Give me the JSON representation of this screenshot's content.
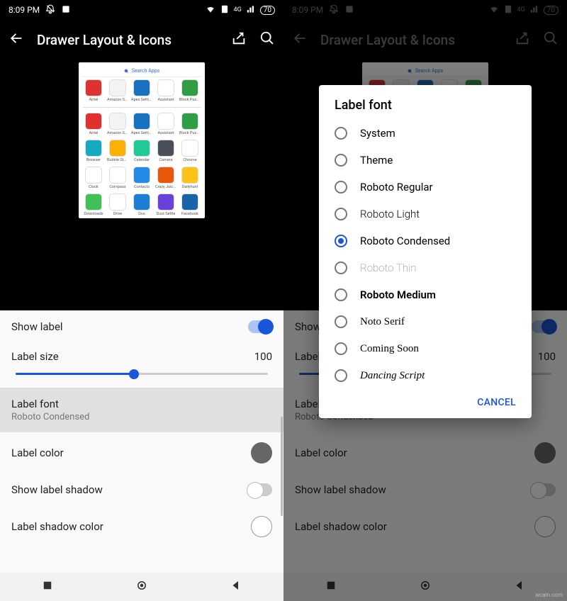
{
  "status": {
    "time": "8:09 PM",
    "battery": "70"
  },
  "appbar": {
    "title": "Drawer Layout & Icons"
  },
  "preview": {
    "search_placeholder": "Search Apps",
    "row1": [
      "Airtel",
      "Amazon Sh..",
      "Apex Settin..",
      "Assistant",
      "Block Puzzl.."
    ],
    "row2": [
      "Airtel",
      "Amazon Sh..",
      "Apex Settin..",
      "Assistant",
      "Block Puzzl.."
    ],
    "row3": [
      "Browser",
      "Bubble Story",
      "Calendar",
      "Camera",
      "Chrome"
    ],
    "row4": [
      "Clock",
      "Compass",
      "Contacts",
      "Crazy Juicer",
      "Dailyhunt"
    ],
    "row5": [
      "Downloads",
      "Drive",
      "Duo",
      "Dust Settle",
      "Facebook"
    ],
    "colors": {
      "r1": [
        "#e03131",
        "#f1f3f5",
        "#1971c2",
        "#ffffff",
        "#2f9e44"
      ],
      "r2": [
        "#e03131",
        "#f1f3f5",
        "#1971c2",
        "#ffffff",
        "#2f9e44"
      ],
      "r3": [
        "#15aabf",
        "#fab005",
        "#20c997",
        "#495057",
        "#ffffff"
      ],
      "r4": [
        "#ffffff",
        "#ffffff",
        "#228be6",
        "#e8590c",
        "#fcc419"
      ],
      "r5": [
        "#40c057",
        "#ffffff",
        "#1c7ed6",
        "#6741d9",
        "#1864ab"
      ]
    }
  },
  "settings": {
    "show_label": "Show label",
    "label_size": "Label size",
    "label_size_value": "100",
    "slider_percent": 47,
    "label_font": "Label font",
    "label_font_value": "Roboto Condensed",
    "label_color": "Label color",
    "show_label_shadow": "Show label shadow",
    "label_shadow_color": "Label shadow color"
  },
  "dialog": {
    "title": "Label font",
    "options": [
      "System",
      "Theme",
      "Roboto Regular",
      "Roboto Light",
      "Roboto Condensed",
      "Roboto Thin",
      "Roboto Medium",
      "Noto Serif",
      "Coming Soon",
      "Dancing Script"
    ],
    "selected_index": 4,
    "cancel": "CANCEL"
  },
  "watermark": "wcaln.com"
}
